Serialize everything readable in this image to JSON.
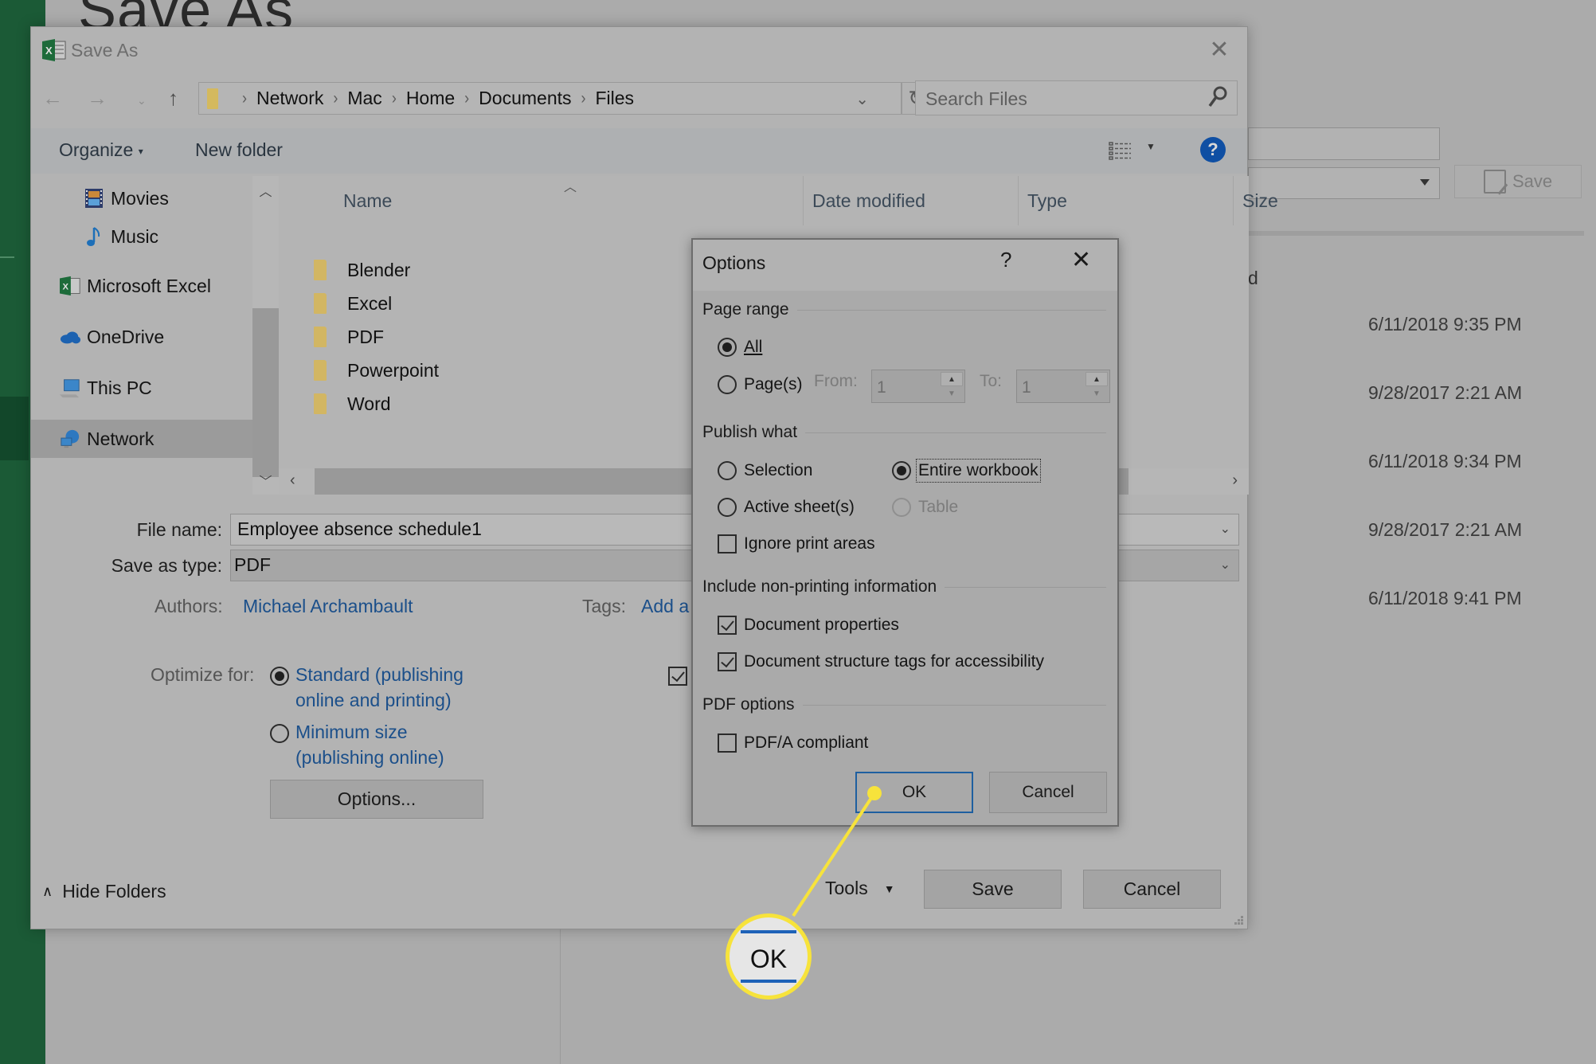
{
  "backstage": {
    "title": "Save As",
    "column_tail": "d",
    "save_label": "Save",
    "dates": [
      "6/11/2018 9:35 PM",
      "9/28/2017 2:21 AM",
      "6/11/2018 9:34 PM",
      "9/28/2017 2:21 AM",
      "6/11/2018 9:41 PM"
    ]
  },
  "save_as": {
    "title": "Save As",
    "close_icon": "close-icon",
    "breadcrumb": [
      "Network",
      "Mac",
      "Home",
      "Documents",
      "Files"
    ],
    "search_placeholder": "Search Files",
    "toolbar": {
      "organize": "Organize",
      "new_folder": "New folder"
    },
    "nav_pane": [
      {
        "label": "Movies",
        "icon": "movies-icon",
        "selected": false
      },
      {
        "label": "Music",
        "icon": "music-icon",
        "selected": false
      },
      {
        "label": "Microsoft Excel",
        "icon": "excel-icon",
        "selected": false
      },
      {
        "label": "OneDrive",
        "icon": "onedrive-icon",
        "selected": false
      },
      {
        "label": "This PC",
        "icon": "computer-icon",
        "selected": false
      },
      {
        "label": "Network",
        "icon": "network-icon",
        "selected": true
      }
    ],
    "columns": [
      "Name",
      "Date modified",
      "Type",
      "Size"
    ],
    "folders": [
      "Blender",
      "Excel",
      "PDF",
      "Powerpoint",
      "Word"
    ],
    "file_name_label": "File name:",
    "file_name_value": "Employee absence schedule1",
    "save_type_label": "Save as type:",
    "save_type_value": "PDF",
    "authors_label": "Authors:",
    "authors_value": "Michael Archambault",
    "tags_label": "Tags:",
    "tags_value": "Add a",
    "optimize_label": "Optimize for:",
    "optimize_options": [
      {
        "line1": "Standard (publishing",
        "line2": "online and printing)",
        "selected": true
      },
      {
        "line1": "Minimum size",
        "line2": "(publishing online)",
        "selected": false
      }
    ],
    "open_after_checked": true,
    "options_button": "Options...",
    "hide_folders": "Hide Folders",
    "tools": "Tools",
    "save_button": "Save",
    "cancel_button": "Cancel"
  },
  "options_dialog": {
    "title": "Options",
    "help": "?",
    "page_range": {
      "heading": "Page range",
      "all_label": "All",
      "all_selected": true,
      "pages_label": "Page(s)",
      "from_label": "From:",
      "from_value": "1",
      "to_label": "To:",
      "to_value": "1"
    },
    "publish_what": {
      "heading": "Publish what",
      "selection": "Selection",
      "entire_workbook": "Entire workbook",
      "active_sheets": "Active sheet(s)",
      "table": "Table",
      "selected": "Entire workbook",
      "ignore_print_areas": "Ignore print areas",
      "ignore_print_areas_checked": false
    },
    "non_printing": {
      "heading": "Include non-printing information",
      "document_properties": "Document properties",
      "document_properties_checked": true,
      "structure_tags": "Document structure tags for accessibility",
      "structure_tags_checked": true
    },
    "pdf_options": {
      "heading": "PDF options",
      "pdfa": "PDF/A compliant",
      "pdfa_checked": false
    },
    "ok": "OK",
    "cancel": "Cancel"
  },
  "callout": {
    "label": "OK",
    "color": "#f7e33b"
  },
  "colors": {
    "excel_green": "#1b5a36",
    "link_blue": "#1b4f8a",
    "help_blue": "#0f4fa3"
  }
}
